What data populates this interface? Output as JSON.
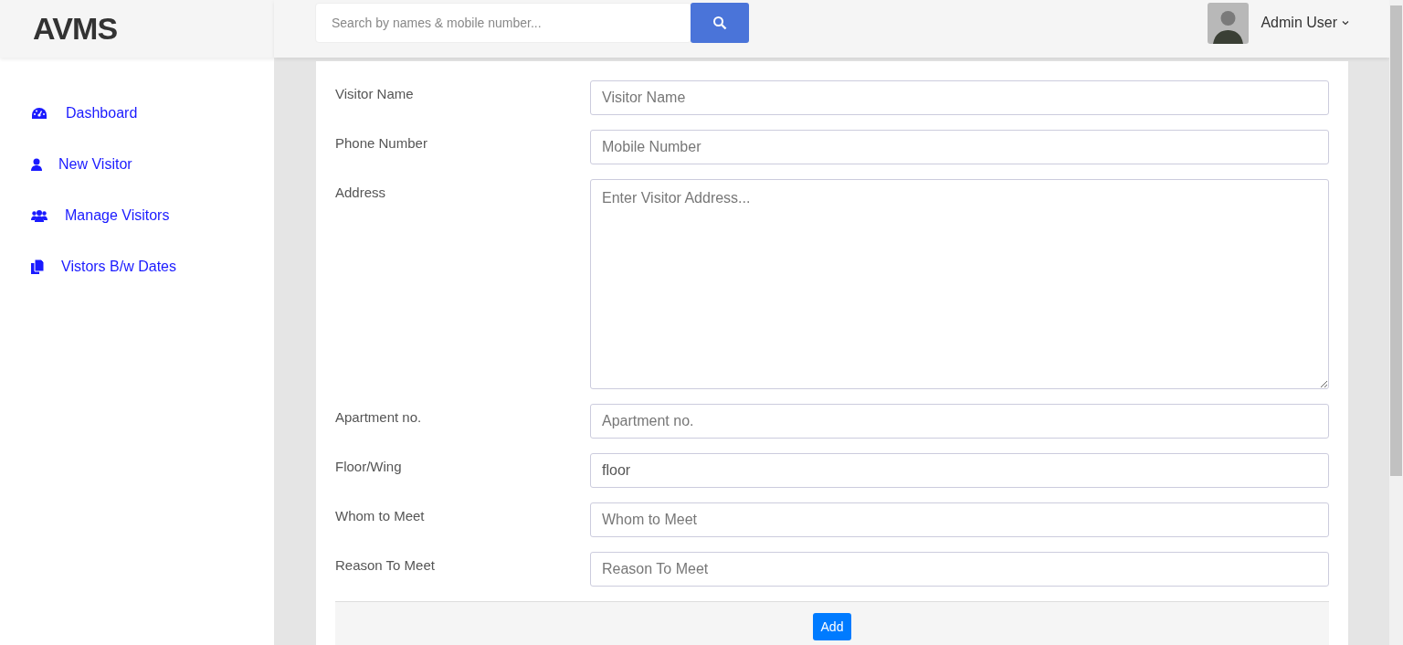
{
  "brand": "AVMS",
  "search": {
    "placeholder": "Search by names & mobile number..."
  },
  "user": {
    "name": "Admin User"
  },
  "sidebar": {
    "items": [
      {
        "label": "Dashboard"
      },
      {
        "label": "New Visitor"
      },
      {
        "label": "Manage Visitors"
      },
      {
        "label": "Vistors B/w Dates"
      }
    ]
  },
  "form": {
    "fields": [
      {
        "kind": "input",
        "label": "Visitor Name",
        "placeholder": "Visitor Name"
      },
      {
        "kind": "input",
        "label": "Phone Number",
        "placeholder": "Mobile Number"
      },
      {
        "kind": "textarea",
        "label": "Address",
        "placeholder": "Enter Visitor Address..."
      },
      {
        "kind": "input",
        "label": "Apartment no.",
        "placeholder": "Apartment no."
      },
      {
        "kind": "input",
        "label": "Floor/Wing",
        "value": "floor"
      },
      {
        "kind": "input",
        "label": "Whom to Meet",
        "placeholder": "Whom to Meet"
      },
      {
        "kind": "input",
        "label": "Reason To Meet",
        "placeholder": "Reason To Meet"
      }
    ],
    "submit": "Add"
  }
}
